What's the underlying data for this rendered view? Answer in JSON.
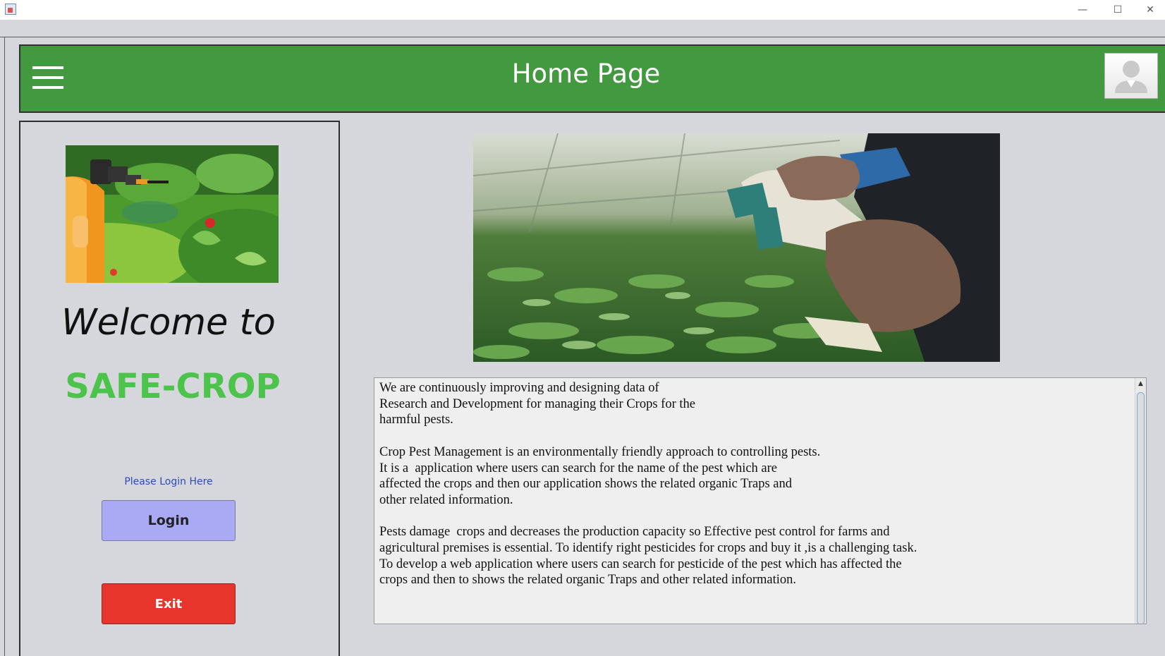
{
  "window": {
    "minimize_glyph": "—",
    "maximize_glyph": "☐",
    "close_glyph": "✕"
  },
  "header": {
    "title": "Home Page",
    "menu_icon": "hamburger-menu-icon",
    "profile_icon": "user-avatar-icon",
    "background_color": "#43993f"
  },
  "left_panel": {
    "image_alt": "pesticide sprayer over plants",
    "welcome_text": "Welcome to",
    "brand_name": "SAFE-CROP",
    "brand_color": "#4cc34a",
    "login_hint": "Please Login Here",
    "login_label": "Login",
    "exit_label": "Exit"
  },
  "main": {
    "hero_alt": "hands spraying seedlings in greenhouse",
    "paragraphs": [
      [
        "We are continuously improving and designing data of",
        "Research and Development for managing their Crops for the",
        "harmful pests."
      ],
      [
        "Crop Pest Management is an environmentally friendly approach to controlling pests.",
        "It is a  application where users can search for the name of the pest which are",
        "affected the crops and then our application shows the related organic Traps and",
        "other related information."
      ],
      [
        "Pests damage  crops and decreases the production capacity so Effective pest control for farms and",
        "agricultural premises is essential. To identify right pesticides for crops and buy it ,is a challenging task.",
        "To develop a web application where users can search for pesticide of the pest which has affected the",
        "crops and then to shows the related organic Traps and other related information."
      ]
    ]
  }
}
